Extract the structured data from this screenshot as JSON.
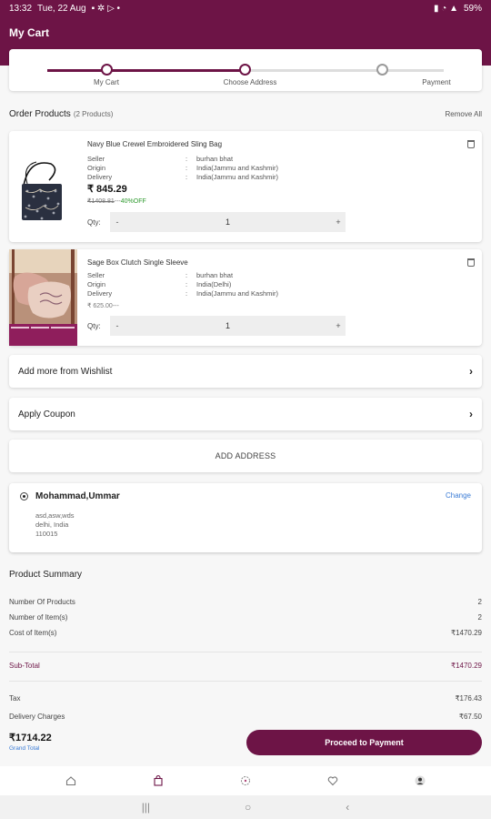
{
  "status": {
    "time": "13:32",
    "date": "Tue, 22 Aug",
    "battery": "59%"
  },
  "app": {
    "title": "My Cart",
    "accent": "#6d1446"
  },
  "stepper": {
    "steps": [
      "My Cart",
      "Choose Address",
      "Payment"
    ]
  },
  "order": {
    "title": "Order Products",
    "count": "(2 Products)",
    "remove_all": "Remove All"
  },
  "products": [
    {
      "name": "Navy Blue Crewel Embroidered Sling Bag",
      "specs": [
        {
          "k": "Seller",
          "v": "burhan bhat"
        },
        {
          "k": "Origin",
          "v": "India(Jammu and Kashmir)"
        },
        {
          "k": "Delivery",
          "v": "India(Jammu and Kashmir)"
        }
      ],
      "price": "₹ 845.29",
      "mrp": "₹1408.81",
      "sep": "---",
      "off": "40%OFF",
      "qty_label": "Qty:",
      "qty": "1"
    },
    {
      "name": "Sage Box Clutch Single Sleeve",
      "specs": [
        {
          "k": "Seller",
          "v": "burhan bhat"
        },
        {
          "k": "Origin",
          "v": "India(Delhi)"
        },
        {
          "k": "Delivery",
          "v": "India(Jammu and Kashmir)"
        }
      ],
      "mrp": "₹ 625.00",
      "sep": "---",
      "qty_label": "Qty:",
      "qty": "1"
    }
  ],
  "wishlist_label": "Add more from Wishlist",
  "coupon_label": "Apply Coupon",
  "add_address_label": "ADD ADDRESS",
  "address": {
    "name": "Mohammad,Ummar",
    "change": "Change",
    "lines": [
      "asd,asw,wds",
      "delhi, India",
      "110015"
    ]
  },
  "summary": {
    "title": "Product Summary",
    "rows": [
      {
        "k": "Number Of Products",
        "v": "2"
      },
      {
        "k": "Number of Item(s)",
        "v": "2"
      },
      {
        "k": "Cost of Item(s)",
        "v": "₹1470.29"
      }
    ],
    "subtotal": {
      "k": "Sub-Total",
      "v": "₹1470.29"
    },
    "tax": {
      "k": "Tax",
      "v": "₹176.43"
    },
    "delivery": {
      "k": "Delivery Charges",
      "v": "₹67.50"
    }
  },
  "total": {
    "amount": "₹1714.22",
    "label": "Grand Total",
    "button": "Proceed to Payment"
  },
  "icons": [
    "home-icon",
    "bag-icon",
    "categories-icon",
    "heart-icon",
    "profile-icon"
  ]
}
